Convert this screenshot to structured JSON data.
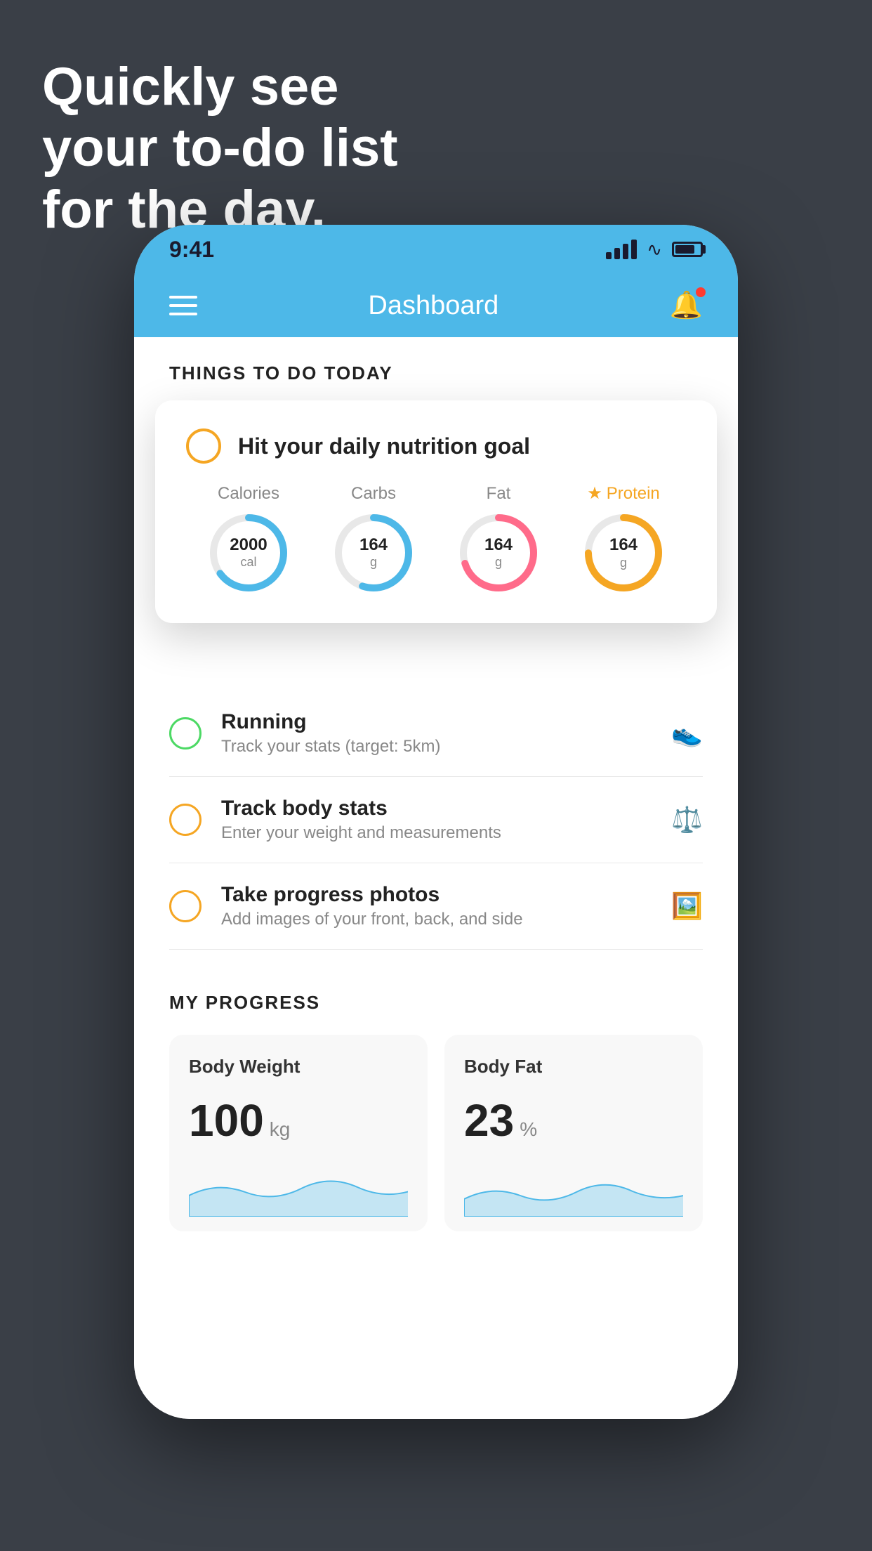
{
  "hero": {
    "line1": "Quickly see",
    "line2": "your to-do list",
    "line3": "for the day."
  },
  "statusBar": {
    "time": "9:41"
  },
  "navbar": {
    "title": "Dashboard"
  },
  "sectionHeader": "THINGS TO DO TODAY",
  "floatingCard": {
    "title": "Hit your daily nutrition goal",
    "items": [
      {
        "label": "Calories",
        "value": "2000",
        "unit": "cal",
        "color": "#4db8e8",
        "pct": 65
      },
      {
        "label": "Carbs",
        "value": "164",
        "unit": "g",
        "color": "#4db8e8",
        "pct": 55
      },
      {
        "label": "Fat",
        "value": "164",
        "unit": "g",
        "color": "#ff6b8a",
        "pct": 70
      },
      {
        "label": "Protein",
        "value": "164",
        "unit": "g",
        "color": "#f5a623",
        "pct": 75,
        "starred": true
      }
    ]
  },
  "todoItems": [
    {
      "title": "Running",
      "subtitle": "Track your stats (target: 5km)",
      "circleColor": "green",
      "icon": "👟"
    },
    {
      "title": "Track body stats",
      "subtitle": "Enter your weight and measurements",
      "circleColor": "yellow",
      "icon": "⚖️"
    },
    {
      "title": "Take progress photos",
      "subtitle": "Add images of your front, back, and side",
      "circleColor": "yellow",
      "icon": "🖼️"
    }
  ],
  "progressSection": {
    "header": "MY PROGRESS",
    "cards": [
      {
        "title": "Body Weight",
        "value": "100",
        "unit": "kg"
      },
      {
        "title": "Body Fat",
        "value": "23",
        "unit": "%"
      }
    ]
  }
}
